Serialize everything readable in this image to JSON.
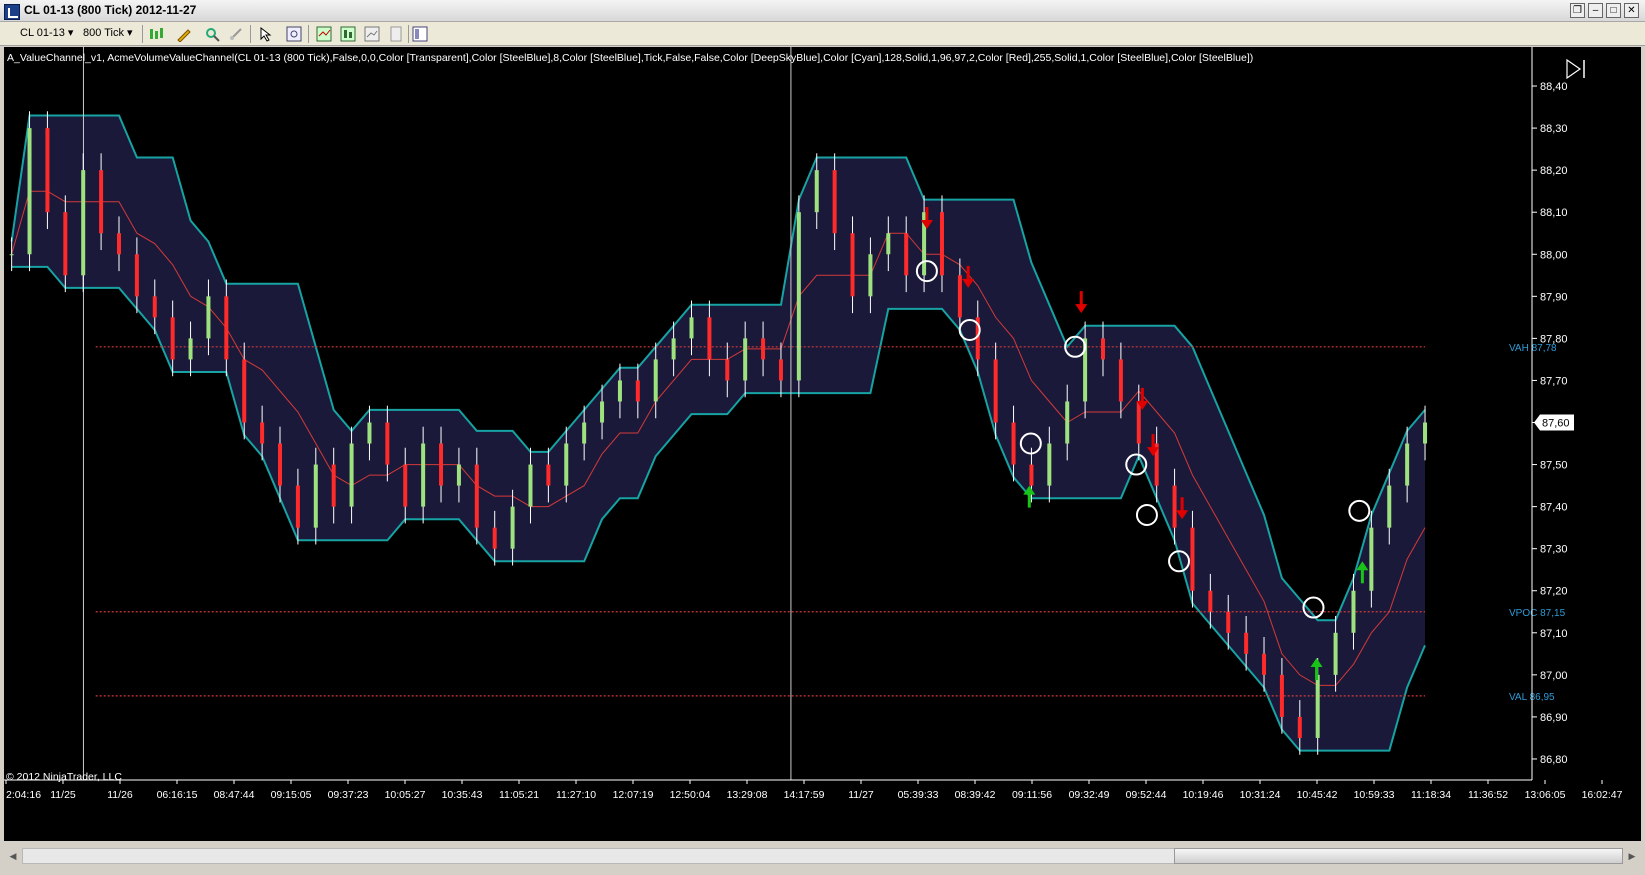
{
  "window": {
    "title": "CL 01-13 (800 Tick)  2012-11-27",
    "buttons": [
      "❐",
      "–",
      "□",
      "✕"
    ]
  },
  "toolbar": {
    "instrument": "CL 01-13",
    "period": "800 Tick",
    "icons": [
      "bar-style-icon",
      "pencil-draw-icon",
      "zoom-icon",
      "pointer-icon",
      "crosshair-icon",
      "indicators-icon",
      "strategies-icon",
      "data-box-icon",
      "properties-icon",
      "templates-icon"
    ]
  },
  "colors": {
    "background": "#000000",
    "up_bar": "#9ee27f",
    "down_bar": "#ff2a2a",
    "cloud_fill": "#1c1a3c",
    "channel_line": "#17a3a3",
    "outer_line": "#2b5566",
    "poc_line": "#d23a3a",
    "signal_down": "#e10000",
    "signal_up": "#18c418",
    "circle": "#ffffff",
    "axis_text": "#ffffff",
    "value_labels": "#2e9bd6"
  },
  "chart_data": {
    "type": "candlestick",
    "indicator_text": "A_ValueChannel_v1, AcmeVolumeValueChannel(CL 01-13 (800 Tick),False,0,0,Color [Transparent],Color [SteelBlue],8,Color [SteelBlue],Tick,False,False,Color [DeepSkyBlue],Color [Cyan],128,Solid,1,96,97,2,Color [Red],255,Solid,1,Color [SteelBlue],Color [SteelBlue])",
    "copyright": "© 2012 NinjaTrader, LLC",
    "ylim": [
      86.75,
      88.45
    ],
    "y_ticks": [
      "88,40",
      "88,30",
      "88,20",
      "88,10",
      "88,00",
      "87,90",
      "87,80",
      "87,70",
      "87,60",
      "87,50",
      "87,40",
      "87,30",
      "87,20",
      "87,10",
      "87,00",
      "86,90",
      "86,80"
    ],
    "x_ticks": [
      "2:04:16",
      "11/25",
      "11/26",
      "06:16:15",
      "08:47:44",
      "09:15:05",
      "09:37:23",
      "10:05:27",
      "10:35:43",
      "11:05:21",
      "11:27:10",
      "12:07:19",
      "12:50:04",
      "13:29:08",
      "14:17:59",
      "11/27",
      "05:39:33",
      "08:39:42",
      "09:11:56",
      "09:32:49",
      "09:52:44",
      "10:19:46",
      "10:31:24",
      "10:45:42",
      "10:59:33",
      "11:18:34",
      "11:36:52",
      "13:06:05",
      "16:02:47"
    ],
    "last_price": "87,60",
    "value_labels": [
      {
        "text": "VAH 87,78",
        "value": 87.78,
        "kind": "vah"
      },
      {
        "text": "VPOC 87,15",
        "value": 87.15,
        "kind": "vpoc"
      },
      {
        "text": "VAL 86,95",
        "value": 86.95,
        "kind": "val"
      }
    ],
    "series_close": [
      88.0,
      88.3,
      88.1,
      87.95,
      88.2,
      88.05,
      88.0,
      87.9,
      87.85,
      87.75,
      87.8,
      87.9,
      87.75,
      87.6,
      87.55,
      87.45,
      87.35,
      87.5,
      87.4,
      87.55,
      87.6,
      87.5,
      87.4,
      87.55,
      87.45,
      87.5,
      87.35,
      87.3,
      87.4,
      87.5,
      87.45,
      87.55,
      87.6,
      87.65,
      87.7,
      87.65,
      87.75,
      87.8,
      87.85,
      87.75,
      87.7,
      87.8,
      87.75,
      87.7,
      88.1,
      88.2,
      88.05,
      87.9,
      88.0,
      88.05,
      87.95,
      88.1,
      87.95,
      87.85,
      87.75,
      87.6,
      87.5,
      87.45,
      87.55,
      87.65,
      87.8,
      87.75,
      87.65,
      87.55,
      87.45,
      87.35,
      87.2,
      87.15,
      87.1,
      87.05,
      87.0,
      86.9,
      86.85,
      87.0,
      87.1,
      87.2,
      87.35,
      87.45,
      87.55,
      87.6
    ],
    "arrows_down": [
      {
        "x_frac": 0.604,
        "y": 88.06
      },
      {
        "x_frac": 0.631,
        "y": 87.92
      },
      {
        "x_frac": 0.705,
        "y": 87.86
      },
      {
        "x_frac": 0.745,
        "y": 87.63
      },
      {
        "x_frac": 0.752,
        "y": 87.52
      },
      {
        "x_frac": 0.771,
        "y": 87.37
      }
    ],
    "arrows_up": [
      {
        "x_frac": 0.671,
        "y": 87.45
      },
      {
        "x_frac": 0.859,
        "y": 87.04
      },
      {
        "x_frac": 0.889,
        "y": 87.27
      }
    ],
    "circles": [
      {
        "x_frac": 0.604,
        "y": 87.96
      },
      {
        "x_frac": 0.632,
        "y": 87.82
      },
      {
        "x_frac": 0.672,
        "y": 87.55
      },
      {
        "x_frac": 0.701,
        "y": 87.78
      },
      {
        "x_frac": 0.741,
        "y": 87.5
      },
      {
        "x_frac": 0.748,
        "y": 87.38
      },
      {
        "x_frac": 0.769,
        "y": 87.27
      },
      {
        "x_frac": 0.857,
        "y": 87.16
      },
      {
        "x_frac": 0.887,
        "y": 87.39
      }
    ]
  }
}
